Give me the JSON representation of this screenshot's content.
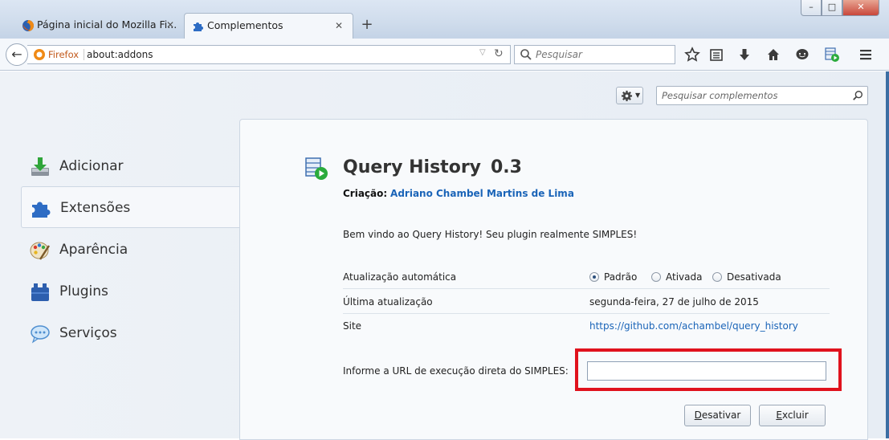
{
  "tabs": [
    {
      "title": "Página inicial do Mozilla Fi...",
      "active": false,
      "icon": "firefox-icon"
    },
    {
      "title": "Complementos",
      "active": true,
      "icon": "puzzle-icon"
    }
  ],
  "window_controls": {
    "minimize": "–",
    "maximize": "□",
    "close": "✕"
  },
  "navbar": {
    "identity_label": "Firefox",
    "url": "about:addons",
    "search_placeholder": "Pesquisar"
  },
  "addons_manager": {
    "search_placeholder": "Pesquisar complementos",
    "categories": [
      {
        "label": "Adicionar",
        "icon": "download-icon",
        "selected": false
      },
      {
        "label": "Extensões",
        "icon": "puzzle-icon",
        "selected": true
      },
      {
        "label": "Aparência",
        "icon": "palette-icon",
        "selected": false
      },
      {
        "label": "Plugins",
        "icon": "plugin-icon",
        "selected": false
      },
      {
        "label": "Serviços",
        "icon": "chat-icon",
        "selected": false
      }
    ],
    "detail": {
      "name": "Query History",
      "version": "0.3",
      "creator_label": "Criação:",
      "creator_name": "Adriano Chambel Martins de Lima",
      "description": "Bem vindo ao Query History! Seu plugin realmente SIMPLES!",
      "auto_update_label": "Atualização automática",
      "auto_update_options": [
        "Padrão",
        "Ativada",
        "Desativada"
      ],
      "auto_update_selected": "Padrão",
      "last_update_label": "Última atualização",
      "last_update_value": "segunda-feira, 27 de julho de 2015",
      "site_label": "Site",
      "site_value": "https://github.com/achambel/query_history",
      "url_pref_label": "Informe a URL de execução direta do SIMPLES:",
      "url_pref_value": "",
      "disable_button": {
        "prefix": "",
        "accel": "D",
        "suffix": "esativar"
      },
      "remove_button": {
        "prefix": "",
        "accel": "E",
        "suffix": "xcluir"
      }
    }
  },
  "colors": {
    "highlight_box": "#e0121d",
    "link": "#1a64b8"
  }
}
